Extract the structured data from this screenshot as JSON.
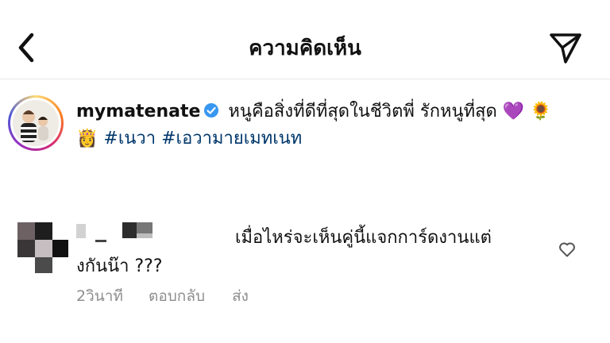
{
  "header": {
    "title": "ความคิดเห็น",
    "back_icon": "chevron-left-icon",
    "share_icon": "paper-plane-icon"
  },
  "caption": {
    "username": "mymatenate",
    "verified_icon": "verified-badge-icon",
    "text": "หนูคือสิ่งที่ดีที่สุดในชีวิตพี่ รักหนูที่สุด",
    "emoji_heart": "💜",
    "emoji_sunflower": "🌻",
    "emoji_princess": "👸",
    "hashtag1": "#เนวา",
    "hashtag2": "#เอวามายเมทเนท",
    "hashtag_color": "#00376b"
  },
  "comment": {
    "text": "เมื่อไหร่จะเห็นคู่นี้แจกการ์ดงานแต่งกันน๊า ???",
    "time": "2วินาที",
    "reply_label": "ตอบกลับ",
    "send_label": "ส่ง",
    "like_icon": "heart-outline-icon"
  },
  "colors": {
    "meta_gray": "#8e8e8e",
    "text": "#111111",
    "divider": "#e6e6e6"
  }
}
